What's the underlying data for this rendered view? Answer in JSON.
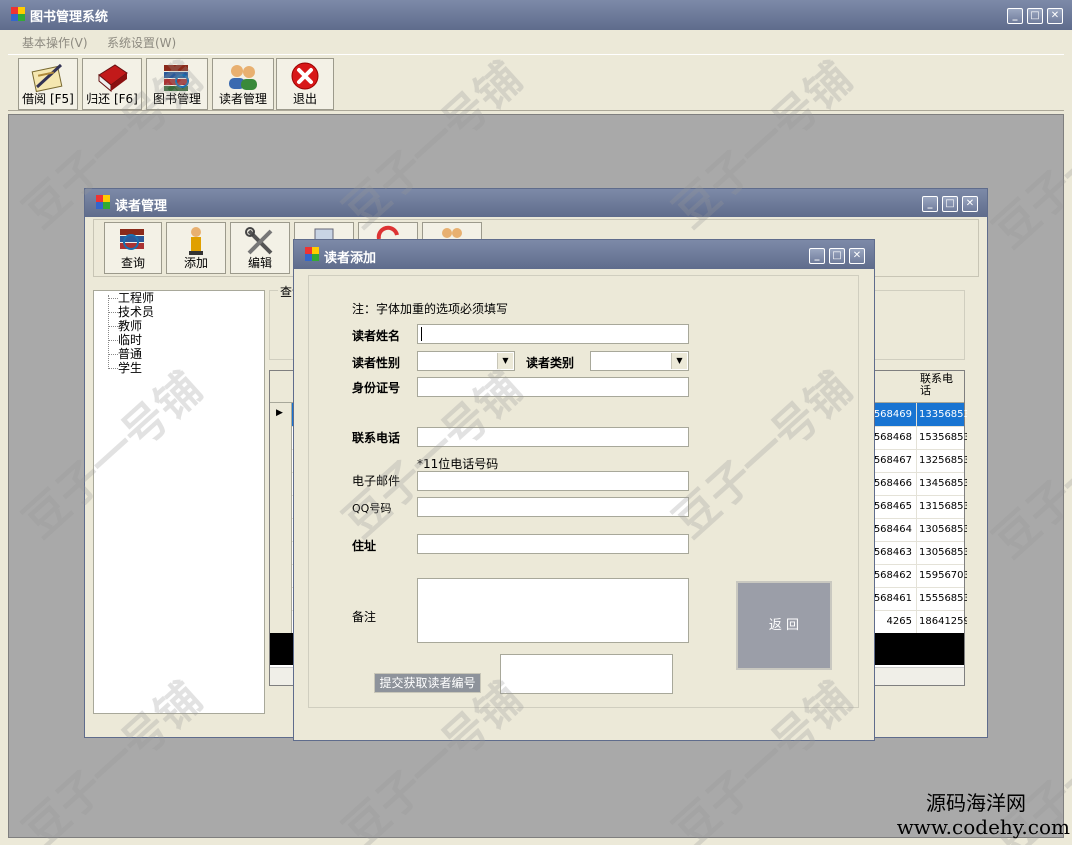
{
  "main_window": {
    "title": "图书管理系统"
  },
  "menu": [
    "基本操作(V)",
    "系统设置(W)"
  ],
  "main_toolbar": [
    "借阅 [F5]",
    "归还 [F6]",
    "图书管理",
    "读者管理",
    "退出"
  ],
  "reader_window": {
    "title": "读者管理",
    "toolbar": [
      "查询",
      "添加",
      "编辑"
    ],
    "tree": [
      "工程师",
      "技术员",
      "教师",
      "临时",
      "普通",
      "学生"
    ],
    "query_label": "查询",
    "grid": {
      "col_header_last": "联系电话",
      "rows": [
        {
          "id": "568469",
          "phone": "13356853"
        },
        {
          "id": "568468",
          "phone": "15356853"
        },
        {
          "id": "568467",
          "phone": "13256853"
        },
        {
          "id": "568466",
          "phone": "13456853"
        },
        {
          "id": "568465",
          "phone": "13156853"
        },
        {
          "id": "568464",
          "phone": "13056853"
        },
        {
          "id": "568463",
          "phone": "13056853"
        },
        {
          "id": "568462",
          "phone": "15956703"
        },
        {
          "id": "568461",
          "phone": "15556853"
        },
        {
          "id": "4265",
          "phone": "18641259"
        }
      ]
    }
  },
  "add_dialog": {
    "title": "读者添加",
    "note": "注：字体加重的选项必须填写",
    "name_label": "读者姓名",
    "gender_label": "读者性别",
    "type_label": "读者类别",
    "id_label": "身份证号",
    "phone_label": "联系电话",
    "phone_hint": "*11位电话号码",
    "email_label": "电子邮件",
    "qq_label": "QQ号码",
    "address_label": "住址",
    "remark_label": "备注",
    "submit_label": "提交获取读者编号",
    "return_label": "返  回"
  },
  "watermark": {
    "text": "豆子一号铺",
    "site_name": "源码海洋网",
    "site_url": "www.codehy.com"
  },
  "colors": {
    "title_bar": "#66728f",
    "form_bg": "#ece9d8",
    "selected": "#1874d2"
  }
}
